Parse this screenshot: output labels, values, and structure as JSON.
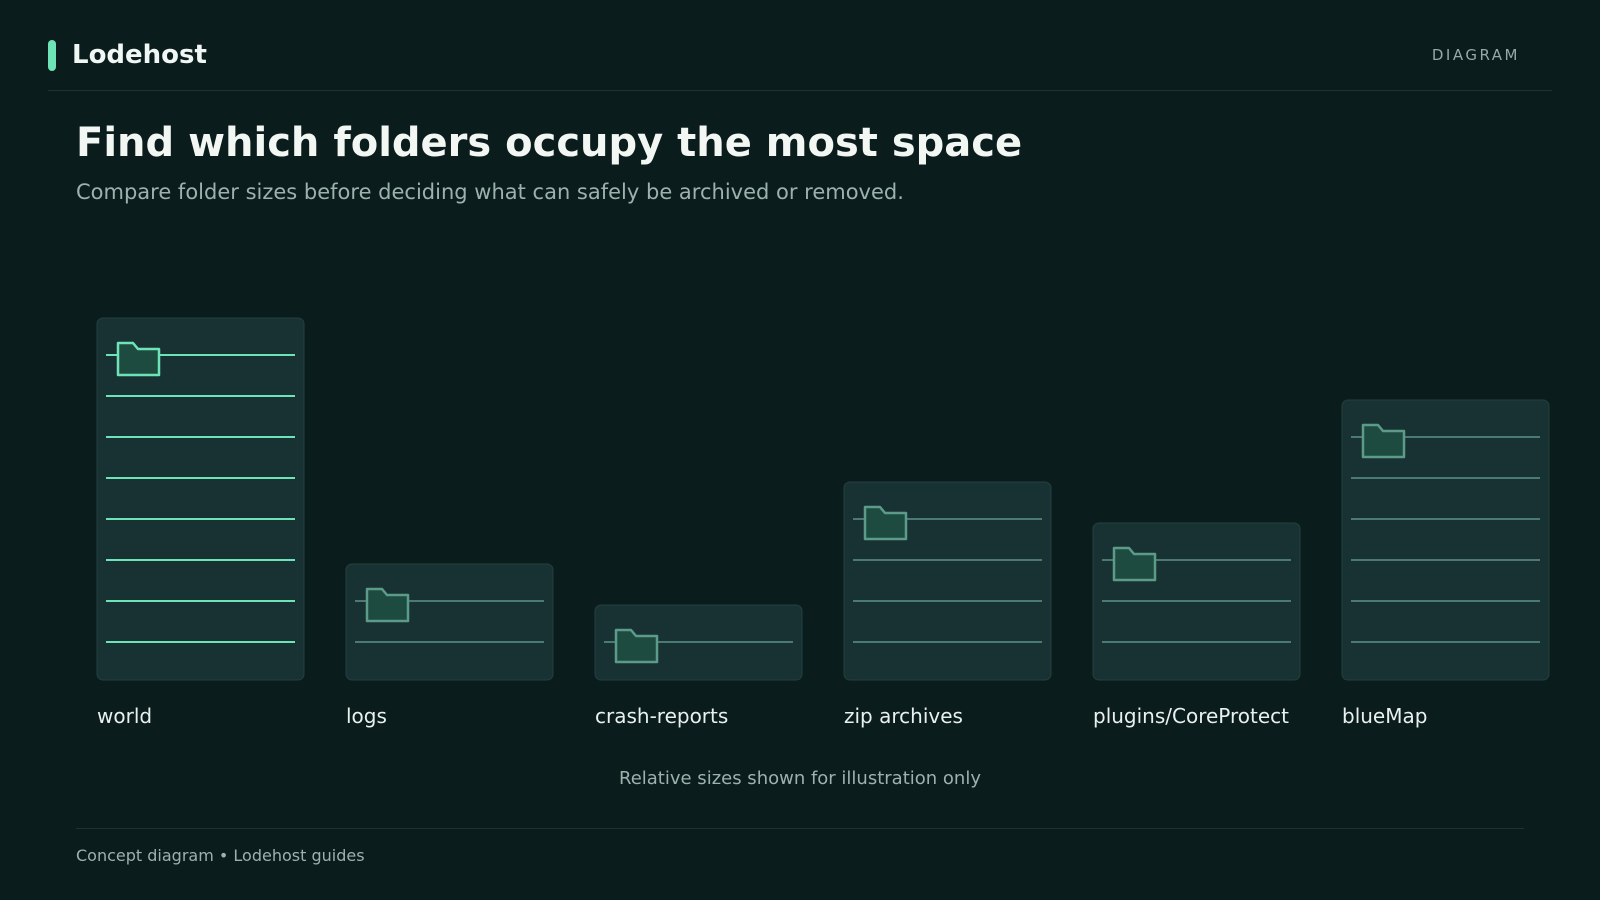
{
  "header": {
    "brand": "Lodehost",
    "tag": "DIAGRAM"
  },
  "page": {
    "title": "Find which folders occupy the most space",
    "subtitle": "Compare folder sizes before deciding what can safely be archived or removed."
  },
  "diagram": {
    "note": "Relative sizes shown for illustration only",
    "folders": [
      {
        "label": "world",
        "relative_size": 8,
        "highlighted": true
      },
      {
        "label": "logs",
        "relative_size": 2,
        "highlighted": false
      },
      {
        "label": "crash-reports",
        "relative_size": 1,
        "highlighted": false
      },
      {
        "label": "zip archives",
        "relative_size": 4,
        "highlighted": false
      },
      {
        "label": "plugins/CoreProtect",
        "relative_size": 3,
        "highlighted": false
      },
      {
        "label": "blueMap",
        "relative_size": 6,
        "highlighted": false
      }
    ],
    "colors": {
      "background": "#0b1c1c",
      "card_fill": "#183233",
      "card_stroke": "#23403f",
      "accent": "#6ee3b7",
      "muted_line": "#5a9287",
      "folder_fill": "#1d4b40",
      "folder_stroke_muted": "#5c9a8a"
    },
    "icon": "folder-icon"
  },
  "footer": {
    "text": "Concept diagram • Lodehost guides"
  }
}
